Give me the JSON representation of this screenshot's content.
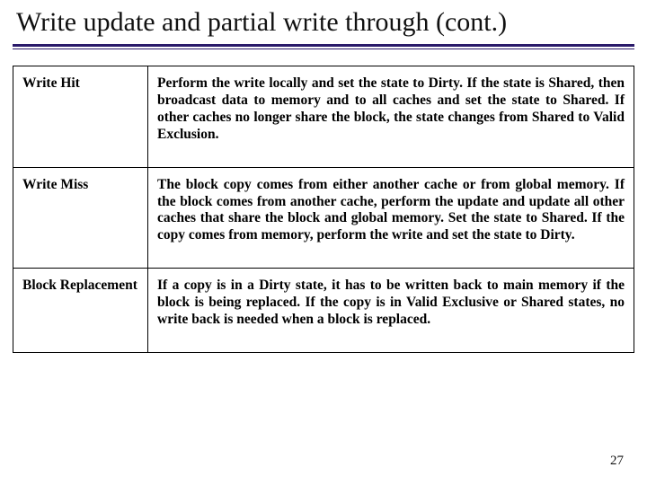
{
  "title": "Write update and partial write through (cont.)",
  "rows": [
    {
      "label": "Write Hit",
      "desc": "Perform the write locally and set the state to Dirty. If the state is Shared, then broadcast data to memory and to all caches and set the state to Shared. If other caches no longer share the block, the state changes from Shared to Valid Exclusion."
    },
    {
      "label": "Write Miss",
      "desc": "The block copy comes from either another cache or from global memory. If the block comes from another cache, perform the update and update all other caches that share the block and global memory. Set the state to Shared.  If the copy comes from memory, perform the write and set the state to Dirty."
    },
    {
      "label": "Block Replacement",
      "desc": "If a copy is in a Dirty state, it has to be written back to main memory if the block is being replaced. If the copy is in Valid Exclusive or Shared states, no write back is needed when a block is replaced."
    }
  ],
  "pageNumber": "27"
}
